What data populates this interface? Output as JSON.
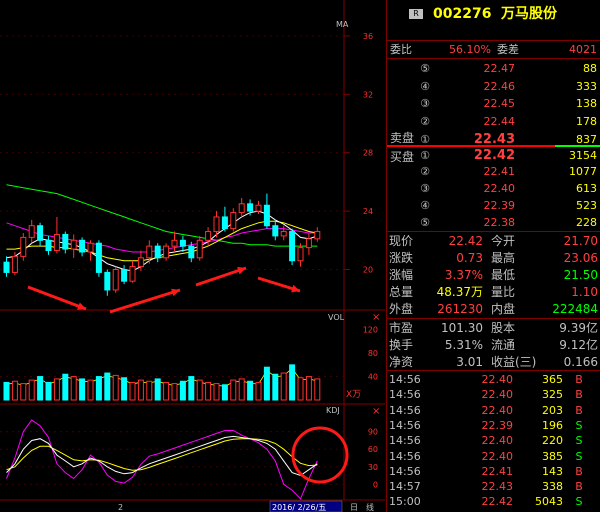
{
  "chart": {
    "main_label": "MA",
    "vol_label": "VOL",
    "kdj_label": "KDJ",
    "y_axis_main": [
      "36",
      "32",
      "28",
      "24",
      "20"
    ],
    "y_axis_vol": [
      "120",
      "80",
      "40"
    ],
    "vol_unit": "X万",
    "y_axis_kdj": [
      "90",
      "60",
      "30",
      "0"
    ],
    "bottom_left_label": "2",
    "date_label": "2016/ 2/26/五",
    "bottom_tab_1": "日",
    "bottom_tab_2": "线",
    "colors": {
      "up": "#ff3030",
      "down": "#00ffff",
      "ma5": "#ffffff",
      "ma10": "#ffff00",
      "ma20": "#ff00ff",
      "ma60": "#00ff00",
      "axis": "#800000"
    },
    "candles": [
      {
        "o": 20.5,
        "c": 19.8,
        "h": 20.9,
        "l": 19.5
      },
      {
        "o": 19.8,
        "c": 20.9,
        "h": 21.2,
        "l": 19.6
      },
      {
        "o": 20.9,
        "c": 22.2,
        "h": 22.5,
        "l": 20.6
      },
      {
        "o": 22.2,
        "c": 23.0,
        "h": 23.4,
        "l": 21.8
      },
      {
        "o": 23.0,
        "c": 22.0,
        "h": 23.2,
        "l": 21.6
      },
      {
        "o": 22.0,
        "c": 21.3,
        "h": 22.3,
        "l": 21.0
      },
      {
        "o": 21.3,
        "c": 22.4,
        "h": 23.6,
        "l": 21.1
      },
      {
        "o": 22.4,
        "c": 21.4,
        "h": 22.6,
        "l": 21.1
      },
      {
        "o": 21.4,
        "c": 22.0,
        "h": 22.4,
        "l": 20.8
      },
      {
        "o": 22.0,
        "c": 21.2,
        "h": 22.2,
        "l": 20.9
      },
      {
        "o": 21.2,
        "c": 21.8,
        "h": 22.0,
        "l": 20.6
      },
      {
        "o": 21.8,
        "c": 19.8,
        "h": 22.0,
        "l": 19.5
      },
      {
        "o": 19.8,
        "c": 18.6,
        "h": 20.0,
        "l": 18.2
      },
      {
        "o": 18.6,
        "c": 20.0,
        "h": 20.2,
        "l": 18.4
      },
      {
        "o": 20.0,
        "c": 19.2,
        "h": 20.3,
        "l": 19.0
      },
      {
        "o": 19.2,
        "c": 20.2,
        "h": 20.6,
        "l": 19.1
      },
      {
        "o": 20.2,
        "c": 20.8,
        "h": 21.3,
        "l": 19.9
      },
      {
        "o": 20.8,
        "c": 21.6,
        "h": 22.0,
        "l": 20.4
      },
      {
        "o": 21.6,
        "c": 20.8,
        "h": 21.8,
        "l": 20.5
      },
      {
        "o": 20.8,
        "c": 21.6,
        "h": 21.8,
        "l": 20.6
      },
      {
        "o": 21.6,
        "c": 22.0,
        "h": 22.6,
        "l": 21.2
      },
      {
        "o": 22.0,
        "c": 21.6,
        "h": 22.3,
        "l": 21.2
      },
      {
        "o": 21.6,
        "c": 20.8,
        "h": 21.9,
        "l": 20.5
      },
      {
        "o": 20.8,
        "c": 22.0,
        "h": 22.3,
        "l": 20.6
      },
      {
        "o": 22.0,
        "c": 22.6,
        "h": 22.9,
        "l": 21.6
      },
      {
        "o": 22.6,
        "c": 23.6,
        "h": 24.0,
        "l": 22.2
      },
      {
        "o": 23.6,
        "c": 22.8,
        "h": 24.3,
        "l": 22.6
      },
      {
        "o": 22.8,
        "c": 23.9,
        "h": 24.2,
        "l": 22.6
      },
      {
        "o": 23.9,
        "c": 24.5,
        "h": 24.9,
        "l": 23.6
      },
      {
        "o": 24.5,
        "c": 24.0,
        "h": 24.8,
        "l": 23.7
      },
      {
        "o": 24.0,
        "c": 24.4,
        "h": 24.7,
        "l": 23.8
      },
      {
        "o": 24.4,
        "c": 23.0,
        "h": 25.2,
        "l": 22.8
      },
      {
        "o": 23.0,
        "c": 22.3,
        "h": 23.4,
        "l": 22.0
      },
      {
        "o": 22.3,
        "c": 22.6,
        "h": 23.0,
        "l": 22.0
      },
      {
        "o": 22.6,
        "c": 20.6,
        "h": 22.8,
        "l": 20.3
      },
      {
        "o": 20.6,
        "c": 21.5,
        "h": 21.8,
        "l": 20.2
      },
      {
        "o": 21.5,
        "c": 22.1,
        "h": 22.5,
        "l": 21.0
      },
      {
        "o": 22.1,
        "c": 22.6,
        "h": 22.9,
        "l": 21.9
      }
    ],
    "ma5": [
      20.8,
      20.9,
      21.3,
      21.8,
      22.1,
      22.0,
      21.9,
      21.8,
      21.7,
      21.5,
      21.2,
      20.8,
      20.4,
      20.2,
      20.0,
      19.9,
      20.2,
      20.6,
      20.9,
      21.1,
      21.2,
      21.3,
      21.4,
      21.6,
      21.9,
      22.4,
      22.8,
      23.2,
      23.6,
      23.9,
      24.0,
      23.8,
      23.4,
      23.1,
      22.7,
      22.2,
      22.1,
      22.3
    ],
    "ma10": [
      21.4,
      21.4,
      21.5,
      21.6,
      21.6,
      21.6,
      21.5,
      21.5,
      21.4,
      21.3,
      21.2,
      21.0,
      20.8,
      20.7,
      20.6,
      20.6,
      20.6,
      20.7,
      20.8,
      20.9,
      21.0,
      21.1,
      21.2,
      21.4,
      21.6,
      21.9,
      22.2,
      22.5,
      22.8,
      23.0,
      23.2,
      23.3,
      23.3,
      23.2,
      23.0,
      22.8,
      22.6,
      22.5
    ],
    "ma20": [
      23.2,
      23.0,
      22.8,
      22.6,
      22.4,
      22.3,
      22.2,
      22.1,
      22.0,
      21.9,
      21.8,
      21.7,
      21.6,
      21.4,
      21.3,
      21.2,
      21.2,
      21.2,
      21.3,
      21.4,
      21.5,
      21.6,
      21.7,
      21.8,
      21.9,
      22.0,
      22.2,
      22.3,
      22.5,
      22.6,
      22.7,
      22.8,
      22.8,
      22.8,
      22.7,
      22.6,
      22.5,
      22.5
    ],
    "ma60": [
      25.8,
      25.7,
      25.6,
      25.5,
      25.4,
      25.3,
      25.2,
      25.0,
      24.8,
      24.6,
      24.4,
      24.2,
      24.0,
      23.8,
      23.6,
      23.4,
      23.2,
      23.0,
      22.8,
      22.6,
      22.5,
      22.4,
      22.3,
      22.2,
      22.1,
      22.0,
      21.9,
      21.8,
      21.8,
      21.7,
      21.7,
      21.7,
      21.6,
      21.6,
      21.6,
      21.6,
      21.6,
      21.6
    ],
    "volumes": [
      30,
      32,
      28,
      34,
      40,
      30,
      36,
      44,
      40,
      36,
      34,
      40,
      46,
      42,
      38,
      30,
      34,
      32,
      36,
      30,
      28,
      32,
      40,
      34,
      30,
      28,
      26,
      34,
      36,
      32,
      30,
      56,
      44,
      46,
      60,
      38,
      40,
      36
    ],
    "kdj_k": [
      20,
      35,
      60,
      75,
      78,
      70,
      50,
      40,
      30,
      35,
      45,
      40,
      30,
      22,
      18,
      20,
      28,
      35,
      40,
      45,
      50,
      55,
      60,
      65,
      70,
      75,
      80,
      82,
      80,
      78,
      75,
      70,
      60,
      40,
      20,
      15,
      25,
      35
    ],
    "kdj_d": [
      25,
      30,
      45,
      58,
      65,
      65,
      58,
      50,
      42,
      40,
      42,
      41,
      37,
      32,
      27,
      24,
      25,
      29,
      34,
      39,
      44,
      49,
      54,
      59,
      64,
      69,
      74,
      77,
      78,
      78,
      77,
      75,
      70,
      60,
      47,
      36,
      32,
      33
    ],
    "kdj_j": [
      10,
      45,
      90,
      110,
      100,
      80,
      35,
      20,
      10,
      25,
      50,
      38,
      16,
      5,
      2,
      12,
      34,
      48,
      52,
      57,
      62,
      67,
      72,
      77,
      82,
      87,
      92,
      92,
      84,
      78,
      71,
      60,
      40,
      0,
      -10,
      -25,
      10,
      40
    ]
  },
  "quote": {
    "badge": "R",
    "code": "002276",
    "name": "万马股份",
    "weibi_label": "委比",
    "weibi_value": "56.10%",
    "weicha_label": "委差",
    "weicha_value": "4021",
    "sell_label": "卖盘",
    "buy_label": "买盘",
    "sell": [
      {
        "level": "⑤",
        "price": "22.47",
        "vol": "88"
      },
      {
        "level": "④",
        "price": "22.46",
        "vol": "333"
      },
      {
        "level": "③",
        "price": "22.45",
        "vol": "138"
      },
      {
        "level": "②",
        "price": "22.44",
        "vol": "178"
      },
      {
        "level": "①",
        "price": "22.43",
        "vol": "837"
      }
    ],
    "buy": [
      {
        "level": "①",
        "price": "22.42",
        "vol": "3154"
      },
      {
        "level": "②",
        "price": "22.41",
        "vol": "1077"
      },
      {
        "level": "③",
        "price": "22.40",
        "vol": "613"
      },
      {
        "level": "④",
        "price": "22.39",
        "vol": "523"
      },
      {
        "level": "⑤",
        "price": "22.38",
        "vol": "228"
      }
    ],
    "stats": [
      {
        "l1": "现价",
        "v1": "22.42",
        "c1": "#ff4040",
        "l2": "今开",
        "v2": "21.70",
        "c2": "#ff4040"
      },
      {
        "l1": "涨跌",
        "v1": "0.73",
        "c1": "#ff4040",
        "l2": "最高",
        "v2": "23.06",
        "c2": "#ff4040"
      },
      {
        "l1": "涨幅",
        "v1": "3.37%",
        "c1": "#ff4040",
        "l2": "最低",
        "v2": "21.50",
        "c2": "#00ff00"
      },
      {
        "l1": "总量",
        "v1": "48.37万",
        "c1": "#ffff00",
        "l2": "量比",
        "v2": "1.10",
        "c2": "#ff4040"
      },
      {
        "l1": "外盘",
        "v1": "261230",
        "c1": "#ff4040",
        "l2": "内盘",
        "v2": "222484",
        "c2": "#00ff00"
      }
    ],
    "stats2": [
      {
        "l1": "市盈",
        "v1": "101.30",
        "l2": "股本",
        "v2": "9.39亿"
      },
      {
        "l1": "换手",
        "v1": "5.31%",
        "l2": "流通",
        "v2": "9.12亿"
      },
      {
        "l1": "净资",
        "v1": "3.01",
        "l2": "收益(三)",
        "v2": "0.166"
      }
    ],
    "ticks": [
      {
        "t": "14:56",
        "p": "22.40",
        "v": "365",
        "f": "B"
      },
      {
        "t": "14:56",
        "p": "22.40",
        "v": "325",
        "f": "B"
      },
      {
        "t": "14:56",
        "p": "22.40",
        "v": "203",
        "f": "B"
      },
      {
        "t": "14:56",
        "p": "22.39",
        "v": "196",
        "f": "S"
      },
      {
        "t": "14:56",
        "p": "22.40",
        "v": "220",
        "f": "S"
      },
      {
        "t": "14:56",
        "p": "22.40",
        "v": "385",
        "f": "S"
      },
      {
        "t": "14:56",
        "p": "22.41",
        "v": "143",
        "f": "B"
      },
      {
        "t": "14:57",
        "p": "22.43",
        "v": "338",
        "f": "B"
      },
      {
        "t": "15:00",
        "p": "22.42",
        "v": "5043",
        "f": "S"
      }
    ]
  }
}
